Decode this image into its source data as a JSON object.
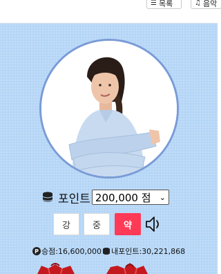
{
  "topbar": {
    "list_button": "목록",
    "right_button": "음악"
  },
  "profile": {
    "photo": "woman-portrait-arms-crossed"
  },
  "points": {
    "label": "포인트",
    "selected": "200,000 점"
  },
  "intensity": {
    "strong": "강",
    "medium": "중",
    "weak": "약",
    "active": "약"
  },
  "stats": {
    "win_label": "승점",
    "win_value": "16,600,000",
    "my_points_label": "내포인트",
    "my_points_value": "30,221,868"
  },
  "colors": {
    "panel": "#b5d6f6",
    "ring": "#7a9bd6",
    "active_button": "#ff3a57"
  }
}
